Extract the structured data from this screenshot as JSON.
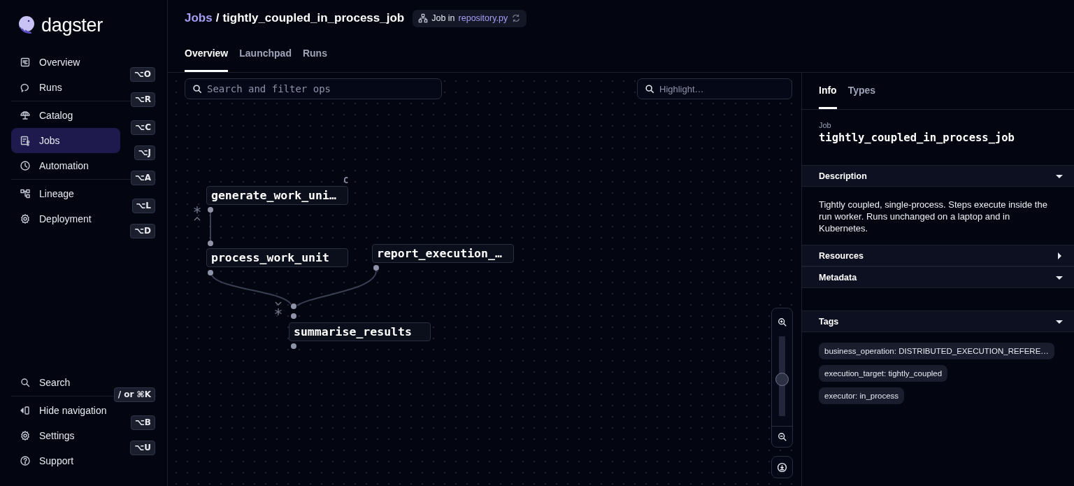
{
  "sidebar": {
    "logo": "dagster",
    "sections": [
      {
        "items": [
          {
            "label": "Overview",
            "shortcut": "⌥O",
            "selected": false
          },
          {
            "label": "Runs",
            "shortcut": "⌥R",
            "selected": false
          }
        ]
      },
      {
        "items": [
          {
            "label": "Catalog",
            "shortcut": "⌥C",
            "selected": false
          },
          {
            "label": "Jobs",
            "shortcut": "⌥J",
            "selected": true
          },
          {
            "label": "Automation",
            "shortcut": "⌥A",
            "selected": false
          }
        ]
      },
      {
        "items": [
          {
            "label": "Lineage",
            "shortcut": "⌥L",
            "selected": false
          },
          {
            "label": "Deployment",
            "shortcut": "⌥D",
            "selected": false
          }
        ]
      }
    ],
    "bottom_sections": [
      {
        "items": [
          {
            "label": "Search",
            "shortcut": "/ or ⌘K",
            "selected": false
          }
        ]
      },
      {
        "items": [
          {
            "label": "Hide navigation",
            "shortcut": "⌥B",
            "selected": false
          },
          {
            "label": "Settings",
            "shortcut": "⌥U",
            "selected": false
          },
          {
            "label": "Support",
            "selected": false
          }
        ]
      }
    ]
  },
  "header": {
    "breadcrumb": {
      "parent": "Jobs",
      "separator": "/",
      "current": "tightly_coupled_in_process_job"
    },
    "location": {
      "prefix": "Job in",
      "repository": "repository.py"
    },
    "tabs": [
      {
        "label": "Overview",
        "selected": true
      },
      {
        "label": "Launchpad",
        "selected": false
      },
      {
        "label": "Runs",
        "selected": false
      }
    ]
  },
  "graph": {
    "search": {
      "placeholder": "Search and filter ops"
    },
    "highlight": {
      "placeholder": "Highlight…"
    },
    "nodes": [
      {
        "name": "generate_work_uni…",
        "badge": "C"
      },
      {
        "name": "process_work_unit"
      },
      {
        "name": "report_execution_…"
      },
      {
        "name": "summarise_results"
      }
    ],
    "zoom": {
      "level": 0.46
    }
  },
  "panel": {
    "tabs": [
      {
        "label": "Info",
        "selected": true
      },
      {
        "label": "Types",
        "selected": false
      }
    ],
    "kind_label": "Job",
    "title": "tightly_coupled_in_process_job",
    "sections": [
      {
        "title": "Description",
        "expanded": true,
        "kind": "text",
        "text": "Tightly coupled, single-process. Steps execute inside the run worker. Runs unchanged on a laptop and in Kubernetes."
      },
      {
        "title": "Resources",
        "expanded": false
      },
      {
        "title": "Metadata",
        "expanded": true,
        "kind": "empty"
      },
      {
        "title": "Tags",
        "expanded": true,
        "kind": "tags",
        "tags": [
          "business_operation: DISTRIBUTED_EXECUTION_REFERE…",
          "execution_target: tightly_coupled",
          "executor: in_process"
        ]
      }
    ]
  }
}
